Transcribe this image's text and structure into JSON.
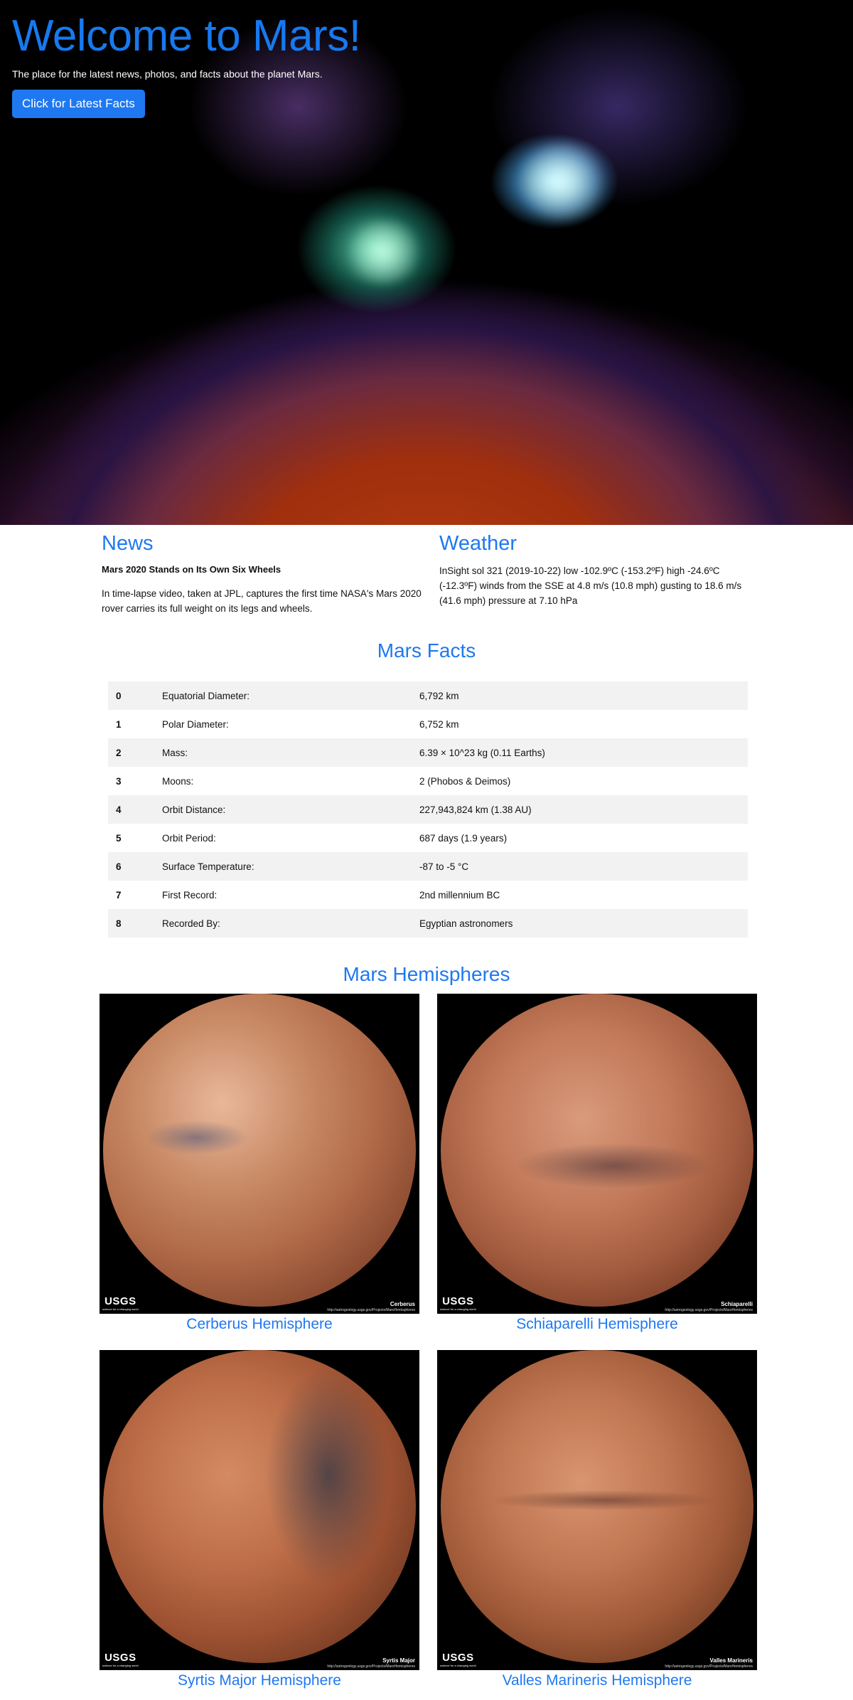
{
  "hero": {
    "title": "Welcome to Mars!",
    "subtitle": "The place for the latest news, photos, and facts about the planet Mars.",
    "button_label": "Click for Latest Facts"
  },
  "news": {
    "heading": "News",
    "title": "Mars 2020 Stands on Its Own Six Wheels",
    "body": "In time-lapse video, taken at JPL, captures the first time NASA's Mars 2020 rover carries its full weight on its legs and wheels."
  },
  "weather": {
    "heading": "Weather",
    "body": "InSight sol 321 (2019-10-22) low -102.9ºC (-153.2ºF) high -24.6ºC (-12.3ºF) winds from the SSE at 4.8 m/s (10.8 mph) gusting to 18.6 m/s (41.6 mph) pressure at 7.10 hPa"
  },
  "facts": {
    "heading": "Mars Facts",
    "rows": [
      {
        "index": "0",
        "label": "Equatorial Diameter:",
        "value": "6,792 km"
      },
      {
        "index": "1",
        "label": "Polar Diameter:",
        "value": "6,752 km"
      },
      {
        "index": "2",
        "label": "Mass:",
        "value": "6.39 × 10^23 kg (0.11 Earths)"
      },
      {
        "index": "3",
        "label": "Moons:",
        "value": "2 (Phobos & Deimos)"
      },
      {
        "index": "4",
        "label": "Orbit Distance:",
        "value": "227,943,824 km (1.38 AU)"
      },
      {
        "index": "5",
        "label": "Orbit Period:",
        "value": "687 days (1.9 years)"
      },
      {
        "index": "6",
        "label": "Surface Temperature:",
        "value": "-87 to -5 °C"
      },
      {
        "index": "7",
        "label": "First Record:",
        "value": "2nd millennium BC"
      },
      {
        "index": "8",
        "label": "Recorded By:",
        "value": "Egyptian astronomers"
      }
    ]
  },
  "hemispheres": {
    "heading": "Mars Hemispheres",
    "usgs_logo": "USGS",
    "usgs_tagline": "science for a changing world",
    "items": [
      {
        "title": "Cerberus Hemisphere",
        "image_label": "Cerberus",
        "image_url": "http://astrogeology.usgs.gov/Projects/MarsHemispheres"
      },
      {
        "title": "Schiaparelli Hemisphere",
        "image_label": "Schiaparelli",
        "image_url": "http://astrogeology.usgs.gov/Projects/MarsHemispheres"
      },
      {
        "title": "Syrtis Major Hemisphere",
        "image_label": "Syrtis Major",
        "image_url": "http://astrogeology.usgs.gov/Projects/MarsHemispheres"
      },
      {
        "title": "Valles Marineris Hemisphere",
        "image_label": "Valles Marineris",
        "image_url": "http://astrogeology.usgs.gov/Projects/MarsHemispheres"
      }
    ]
  },
  "colors": {
    "accent": "#1f78f0",
    "hero_bg": "#000000",
    "table_stripe": "#f2f2f2"
  }
}
